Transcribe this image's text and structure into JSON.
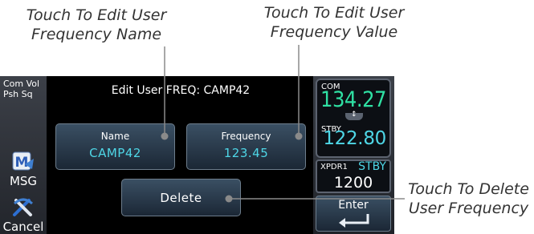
{
  "callouts": {
    "name": [
      "Touch To Edit User",
      "Frequency Name"
    ],
    "value": [
      "Touch To Edit User",
      "Frequency Value"
    ],
    "delete": [
      "Touch To Delete",
      "User Frequency"
    ]
  },
  "screen": {
    "left_bar": {
      "com_vol": [
        "Com Vol",
        "Psh Sq"
      ],
      "msg_label": "MSG",
      "msg_icon": "msg-icon",
      "cancel_label": "Cancel",
      "cancel_icon": "cancel-icon"
    },
    "title": "Edit User FREQ: CAMP42",
    "name_button": {
      "label": "Name",
      "value": "CAMP42"
    },
    "frequency_button": {
      "label": "Frequency",
      "value": "123.45"
    },
    "delete_button": {
      "label": "Delete"
    },
    "right_bar": {
      "com_label": "COM",
      "com_active": "134.27",
      "stby_label": "STBY",
      "com_standby": "122.80",
      "xpdr_label": "XPDR1",
      "xpdr_mode": "STBY",
      "xpdr_code": "1200",
      "enter_label": "Enter",
      "enter_icon": "enter-arrow-icon"
    }
  },
  "colors": {
    "active_freq": "#2fe0a3",
    "cyan_value": "#4ed6e6",
    "button_face": "#2a3c4e",
    "background": "#000000"
  }
}
